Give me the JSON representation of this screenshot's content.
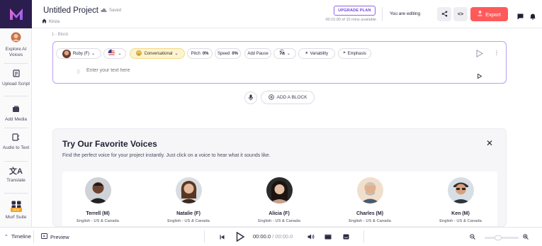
{
  "colors": {
    "accent": "#6f3fd6",
    "export": "#ff5a5a",
    "logo_bg": "#2b1d4e",
    "style_chip": "#fdf3cf"
  },
  "sidebar": {
    "items": [
      {
        "label": "Explore AI Voices",
        "icon": "voices-avatar-icon"
      },
      {
        "label": "Upload Script",
        "icon": "upload-script-icon"
      },
      {
        "label": "Add Media",
        "icon": "media-icon"
      },
      {
        "label": "Audio to Text",
        "icon": "audio-to-text-icon"
      },
      {
        "label": "Translate",
        "icon": "translate-icon"
      },
      {
        "label": "Murf Suite",
        "icon": "suite-grid-icon",
        "badge": "NEW"
      }
    ]
  },
  "header": {
    "title": "Untitled Project",
    "saved": "Saved",
    "breadcrumb": "Kinza",
    "upgrade": "UPGRADE PLAN",
    "time_available": "00:10:00 of 10 mins available",
    "editing": "You are editing",
    "export": "Export"
  },
  "block": {
    "label": "1 - Block",
    "voice": "Ruby (F)",
    "style": "Conversational",
    "pitch_label": "Pitch",
    "pitch_value": "0%",
    "speed_label": "Speed",
    "speed_value": "0%",
    "add_pause": "Add Pause",
    "variability": "Variability",
    "emphasis": "Emphasis",
    "placeholder": "Enter your text here"
  },
  "add_block": "ADD A BLOCK",
  "voices_panel": {
    "title": "Try Our Favorite Voices",
    "description": "Find the perfect voice for your project instantly. Just click on a voice to hear what it sounds like.",
    "voices": [
      {
        "name": "Terrell (M)",
        "lang": "English - US & Canada"
      },
      {
        "name": "Natalie (F)",
        "lang": "English - US & Canada"
      },
      {
        "name": "Alicia (F)",
        "lang": "English - US & Canada"
      },
      {
        "name": "Charles (M)",
        "lang": "English - US & Canada"
      },
      {
        "name": "Ken (M)",
        "lang": "English - US & Canada"
      }
    ]
  },
  "bottom": {
    "timeline": "Timeline",
    "preview": "Preview",
    "current_time": "00:00.0",
    "total_time": "/ 00:00.0"
  }
}
